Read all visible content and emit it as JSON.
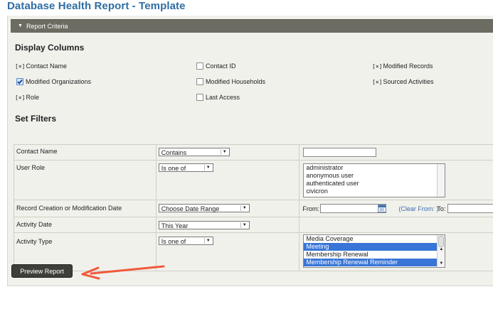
{
  "page": {
    "title": "Database Health Report - Template"
  },
  "criteria": {
    "header_label": "Report Criteria"
  },
  "display_columns": {
    "title": "Display Columns",
    "items": [
      {
        "label": "Contact Name",
        "state": "[x]"
      },
      {
        "label": "Contact ID",
        "state": "unchecked"
      },
      {
        "label": "Modified Records",
        "state": "[x]"
      },
      {
        "label": "Modified Organizations",
        "state": "checked"
      },
      {
        "label": "Modified Households",
        "state": "unchecked"
      },
      {
        "label": "Sourced Activities",
        "state": "[x]"
      },
      {
        "label": "Role",
        "state": "[x]"
      },
      {
        "label": "Last Access",
        "state": "unchecked"
      }
    ],
    "x_mark": "[x]"
  },
  "filters": {
    "title": "Set Filters",
    "rows": [
      {
        "label": "Contact Name",
        "operator": "Contains",
        "value": ""
      },
      {
        "label": "User Role",
        "operator": "Is one of",
        "options": [
          "administrator",
          "anonymous user",
          "authenticated user",
          "civicron"
        ]
      },
      {
        "label": "Record Creation or Modification Date",
        "operator": "Choose Date Range",
        "from_label": "From:",
        "clear_label": "(Clear From: )",
        "to_label": "To:"
      },
      {
        "label": "Activity Date",
        "operator": "This Year"
      },
      {
        "label": "Activity Type",
        "operator": "Is one of",
        "options": [
          "Media Coverage",
          "Meeting",
          "Membership Renewal",
          "Membership Renewal Reminder"
        ],
        "selected": [
          "Meeting",
          "Membership Renewal Reminder"
        ]
      }
    ]
  },
  "actions": {
    "preview_label": "Preview Report"
  },
  "colors": {
    "title": "#2e6da4",
    "header_bg": "#6c6c62",
    "selection": "#3875d7",
    "arrow": "#f05a3c"
  }
}
